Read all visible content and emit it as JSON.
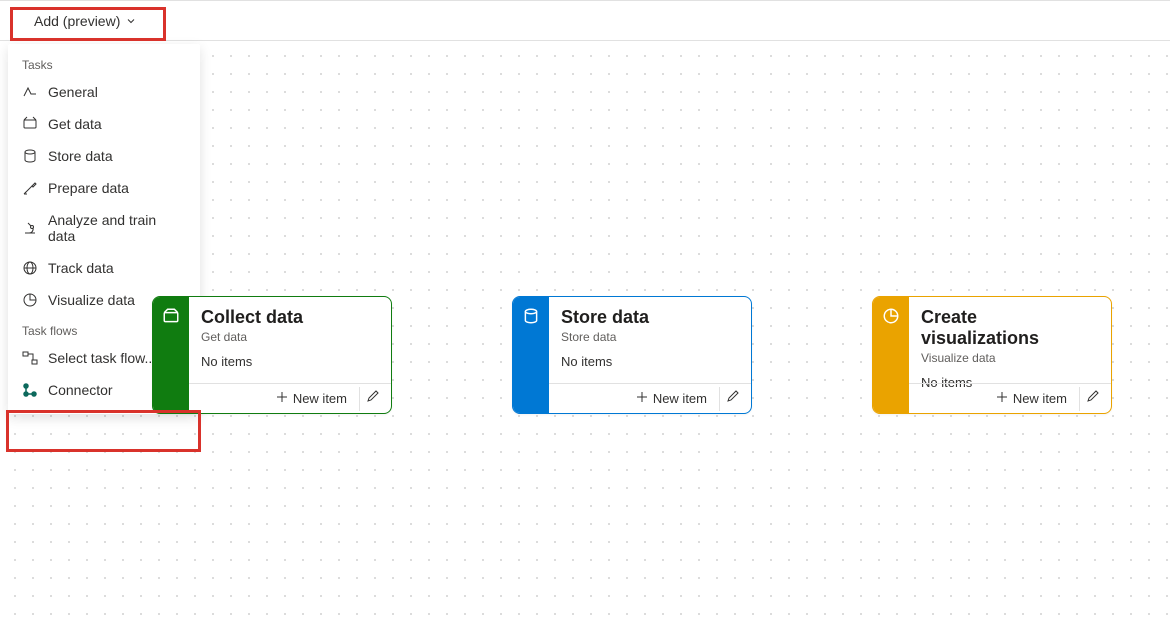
{
  "toolbar": {
    "add_label": "Add (preview)"
  },
  "menu": {
    "section1": "Tasks",
    "items1": [
      {
        "label": "General"
      },
      {
        "label": "Get data"
      },
      {
        "label": "Store data"
      },
      {
        "label": "Prepare data"
      },
      {
        "label": "Analyze and train data"
      },
      {
        "label": "Track data"
      },
      {
        "label": "Visualize data"
      }
    ],
    "section2": "Task flows",
    "items2": [
      {
        "label": "Select task flow..."
      },
      {
        "label": "Connector"
      }
    ]
  },
  "cards": {
    "collect": {
      "title": "Collect data",
      "sub": "Get data",
      "status": "No items",
      "newitem": "New item"
    },
    "store": {
      "title": "Store data",
      "sub": "Store data",
      "status": "No items",
      "newitem": "New item"
    },
    "viz": {
      "title": "Create visualizations",
      "sub": "Visualize data",
      "status": "No items",
      "newitem": "New item"
    }
  }
}
